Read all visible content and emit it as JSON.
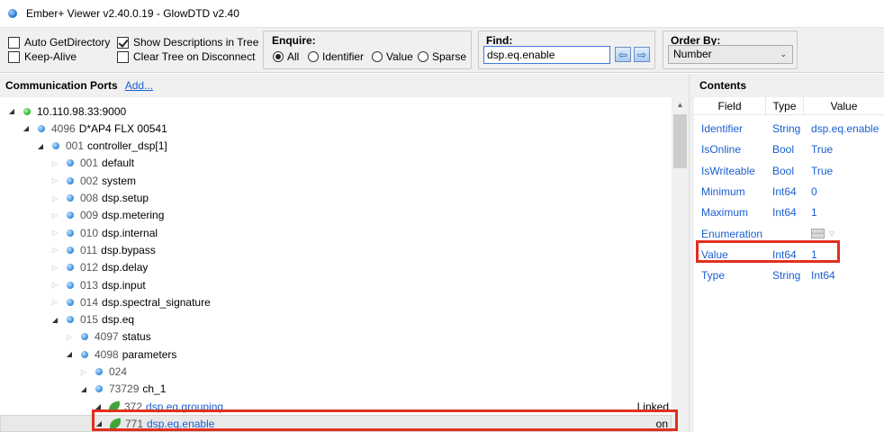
{
  "window": {
    "title": "Ember+ Viewer v2.40.0.19 - GlowDTD v2.40"
  },
  "toolbar": {
    "auto_get_directory": {
      "label": "Auto GetDirectory",
      "checked": false
    },
    "keep_alive": {
      "label": "Keep-Alive",
      "checked": false
    },
    "show_descriptions": {
      "label": "Show Descriptions in Tree",
      "checked": true
    },
    "clear_tree": {
      "label": "Clear Tree on Disconnect",
      "checked": false
    },
    "enquire": {
      "title": "Enquire:",
      "options": [
        "All",
        "Identifier",
        "Value",
        "Sparse"
      ],
      "selected": "All"
    },
    "find": {
      "title": "Find:",
      "value": "dsp.eq.enable",
      "prev": "⇦",
      "next": "⇨"
    },
    "order_by": {
      "title": "Order By:",
      "selected": "Number"
    }
  },
  "left_panel": {
    "title": "Communication Ports",
    "add_link": "Add...",
    "tree": [
      {
        "num": "",
        "label": "10.110.98.33:9000",
        "icon": "green-dot",
        "expanded": true,
        "value": ""
      },
      {
        "num": "4096",
        "label": "D*AP4 FLX 00541",
        "icon": "blue-dot",
        "expanded": true,
        "value": ""
      },
      {
        "num": "001",
        "label": "controller_dsp[1]",
        "icon": "blue-dot",
        "expanded": true,
        "value": ""
      },
      {
        "num": "001",
        "label": "default",
        "icon": "blue-dot",
        "expanded": false,
        "value": ""
      },
      {
        "num": "002",
        "label": "system",
        "icon": "blue-dot",
        "expanded": false,
        "value": ""
      },
      {
        "num": "008",
        "label": "dsp.setup",
        "icon": "blue-dot",
        "expanded": false,
        "value": ""
      },
      {
        "num": "009",
        "label": "dsp.metering",
        "icon": "blue-dot",
        "expanded": false,
        "value": ""
      },
      {
        "num": "010",
        "label": "dsp.internal",
        "icon": "blue-dot",
        "expanded": false,
        "value": ""
      },
      {
        "num": "011",
        "label": "dsp.bypass",
        "icon": "blue-dot",
        "expanded": false,
        "value": ""
      },
      {
        "num": "012",
        "label": "dsp.delay",
        "icon": "blue-dot",
        "expanded": false,
        "value": ""
      },
      {
        "num": "013",
        "label": "dsp.input",
        "icon": "blue-dot",
        "expanded": false,
        "value": ""
      },
      {
        "num": "014",
        "label": "dsp.spectral_signature",
        "icon": "blue-dot",
        "expanded": false,
        "value": ""
      },
      {
        "num": "015",
        "label": "dsp.eq",
        "icon": "blue-dot",
        "expanded": true,
        "value": ""
      },
      {
        "num": "4097",
        "label": "status",
        "icon": "blue-dot",
        "expanded": false,
        "value": ""
      },
      {
        "num": "4098",
        "label": "parameters",
        "icon": "blue-dot",
        "expanded": true,
        "value": ""
      },
      {
        "num": "024",
        "label": "",
        "icon": "blue-dot",
        "expanded": false,
        "value": ""
      },
      {
        "num": "73729",
        "label": "ch_1",
        "icon": "blue-dot",
        "expanded": true,
        "value": ""
      },
      {
        "num": "372",
        "label": "dsp.eq.grouping",
        "icon": "leaf",
        "expanded": true,
        "value": "Linked"
      },
      {
        "num": "771",
        "label": "dsp.eq.enable",
        "icon": "leaf",
        "expanded": true,
        "value": "on"
      }
    ]
  },
  "contents": {
    "title": "Contents",
    "columns": [
      "Field",
      "Type",
      "Value"
    ],
    "rows": [
      {
        "field": "Identifier",
        "type": "String",
        "value": "dsp.eq.enable"
      },
      {
        "field": "IsOnline",
        "type": "Bool",
        "value": "True"
      },
      {
        "field": "IsWriteable",
        "type": "Bool",
        "value": "True"
      },
      {
        "field": "Minimum",
        "type": "Int64",
        "value": "0"
      },
      {
        "field": "Maximum",
        "type": "Int64",
        "value": "1"
      },
      {
        "field": "Enumeration",
        "type": "",
        "value": ""
      },
      {
        "field": "Value",
        "type": "Int64",
        "value": "1"
      },
      {
        "field": "Type",
        "type": "String",
        "value": "Int64"
      }
    ]
  },
  "highlight_color": "#e0301e"
}
